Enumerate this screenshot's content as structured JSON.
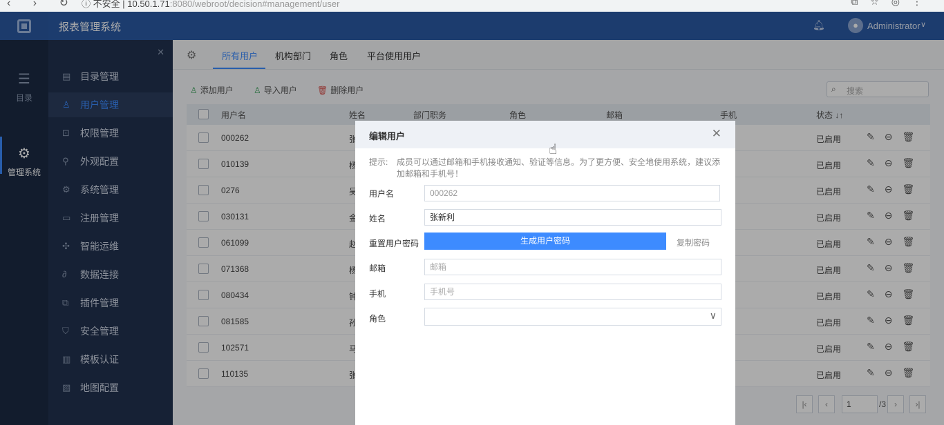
{
  "browser": {
    "url_host": "10.50.1.71",
    "url_path": ":8080/webroot/decision#management/user",
    "security": "不安全"
  },
  "app": {
    "title": "报表管理系统",
    "user": "Administrator"
  },
  "rail": [
    {
      "label": "目录",
      "icon": "list-icon"
    },
    {
      "label": "管理系统",
      "icon": "gear-icon"
    }
  ],
  "sidebar": [
    {
      "label": "目录管理",
      "icon": "catalog-icon"
    },
    {
      "label": "用户管理",
      "icon": "user-icon"
    },
    {
      "label": "权限管理",
      "icon": "lock-icon"
    },
    {
      "label": "外观配置",
      "icon": "brush-icon"
    },
    {
      "label": "系统管理",
      "icon": "settings-icon"
    },
    {
      "label": "注册管理",
      "icon": "register-icon"
    },
    {
      "label": "智能运维",
      "icon": "ops-icon"
    },
    {
      "label": "数据连接",
      "icon": "link-icon"
    },
    {
      "label": "插件管理",
      "icon": "plugin-icon"
    },
    {
      "label": "安全管理",
      "icon": "shield-icon"
    },
    {
      "label": "模板认证",
      "icon": "template-icon"
    },
    {
      "label": "地图配置",
      "icon": "map-icon"
    }
  ],
  "tabs": [
    "所有用户",
    "机构部门",
    "角色",
    "平台使用用户"
  ],
  "toolbar": {
    "add": "添加用户",
    "import": "导入用户",
    "delete": "删除用户",
    "search_placeholder": "搜索"
  },
  "columns": [
    "用户名",
    "姓名",
    "部门职务",
    "角色",
    "邮箱",
    "手机",
    "状态"
  ],
  "rows": [
    {
      "username": "000262",
      "name": "张",
      "status": "已启用"
    },
    {
      "username": "010139",
      "name": "杨",
      "status": "已启用"
    },
    {
      "username": "0276",
      "name": "吴",
      "status": "已启用"
    },
    {
      "username": "030131",
      "name": "金",
      "status": "已启用"
    },
    {
      "username": "061099",
      "name": "赵",
      "status": "已启用"
    },
    {
      "username": "071368",
      "name": "杨",
      "status": "已启用"
    },
    {
      "username": "080434",
      "name": "钟",
      "status": "已启用"
    },
    {
      "username": "081585",
      "name": "孙",
      "status": "已启用"
    },
    {
      "username": "102571",
      "name": "马",
      "status": "已启用"
    },
    {
      "username": "110135",
      "name": "张",
      "status": "已启用"
    }
  ],
  "pager": {
    "page": "1",
    "total": "/3"
  },
  "dialog": {
    "title": "编辑用户",
    "hint_label": "提示:",
    "hint_text": "成员可以通过邮箱和手机接收通知、验证等信息。为了更方便、安全地使用系统，建议添加邮箱和手机号！",
    "username_label": "用户名",
    "username_value": "000262",
    "name_label": "姓名",
    "name_value": "张新利",
    "reset_label": "重置用户密码",
    "generate_button": "生成用户密码",
    "copy_button": "复制密码",
    "email_label": "邮箱",
    "email_placeholder": "邮箱",
    "phone_label": "手机",
    "phone_placeholder": "手机号",
    "role_label": "角色"
  },
  "colors": {
    "topbar": "#2b5aa5",
    "sidebar": "#22324f",
    "rail": "#1b2a44",
    "accent": "#3d8bff"
  }
}
